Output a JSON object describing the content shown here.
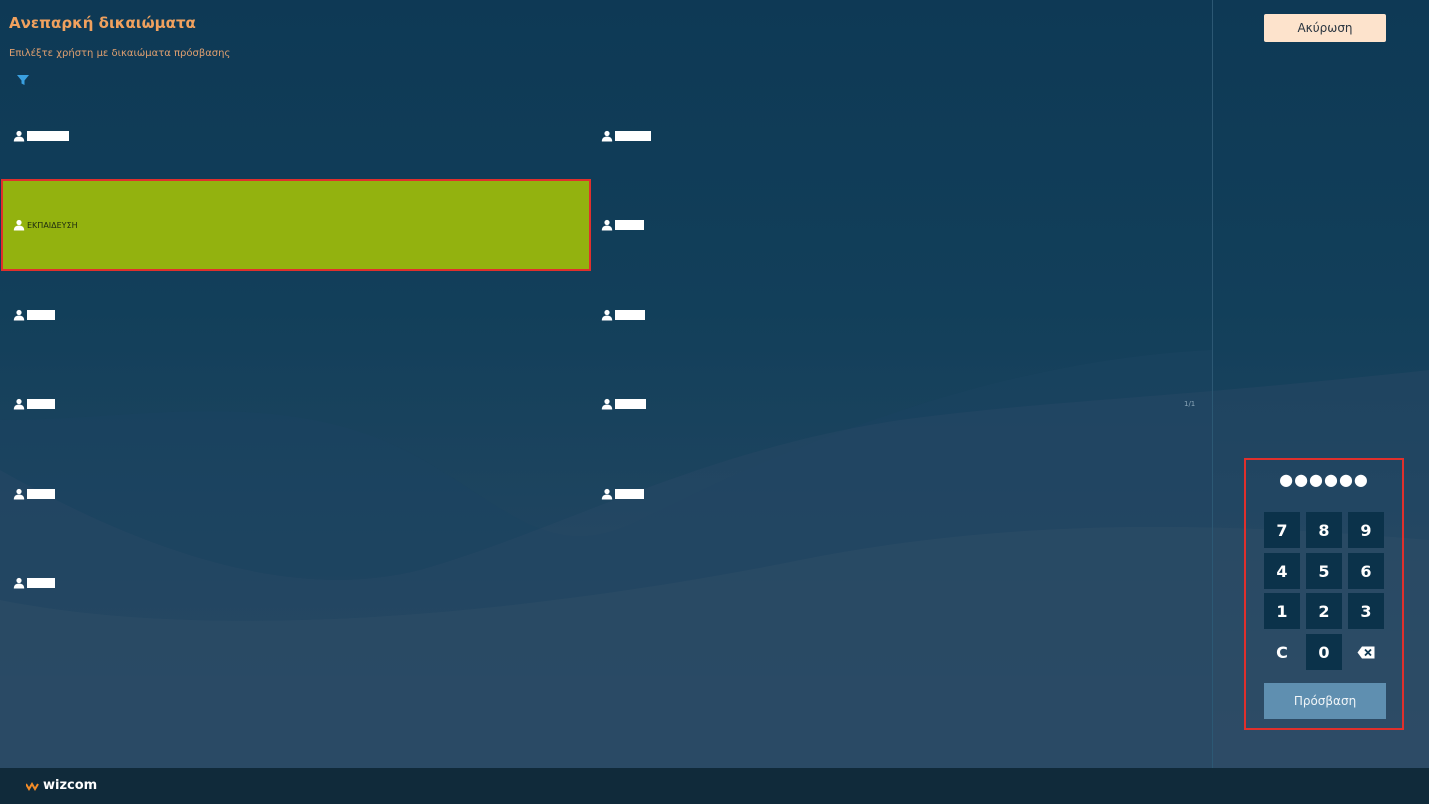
{
  "header": {
    "title": "Ανεπαρκή δικαιώματα",
    "subtitle": "Επιλέξτε χρήστη με δικαιώματα πρόσβασης"
  },
  "users": [
    {
      "name": "",
      "selected": false
    },
    {
      "name": "",
      "selected": false
    },
    {
      "name": "ΕΚΠΑΙΔΕΥΣΗ",
      "selected": true
    },
    {
      "name": "",
      "selected": false
    },
    {
      "name": "",
      "selected": false
    },
    {
      "name": "",
      "selected": false
    },
    {
      "name": "",
      "selected": false
    },
    {
      "name": "",
      "selected": false
    },
    {
      "name": "",
      "selected": false
    },
    {
      "name": "",
      "selected": false
    },
    {
      "name": "",
      "selected": false
    }
  ],
  "pagination": {
    "indicator": "1/1"
  },
  "sidebar": {
    "cancel_label": "Ακύρωση",
    "pin_display": "●●●●●●",
    "keys": [
      "7",
      "8",
      "9",
      "4",
      "5",
      "6",
      "1",
      "2",
      "3",
      "C",
      "0"
    ],
    "backspace_icon": "backspace-icon",
    "access_label": "Πρόσβαση"
  },
  "footer": {
    "logo_text": "wizcom"
  },
  "colors": {
    "title": "#f0a15e",
    "selected_bg": "#93b20f",
    "highlight_border": "#e0302c",
    "cancel_bg": "#fde3cc",
    "access_bg": "#5f8fb0",
    "key_bg": "#0b324a"
  }
}
